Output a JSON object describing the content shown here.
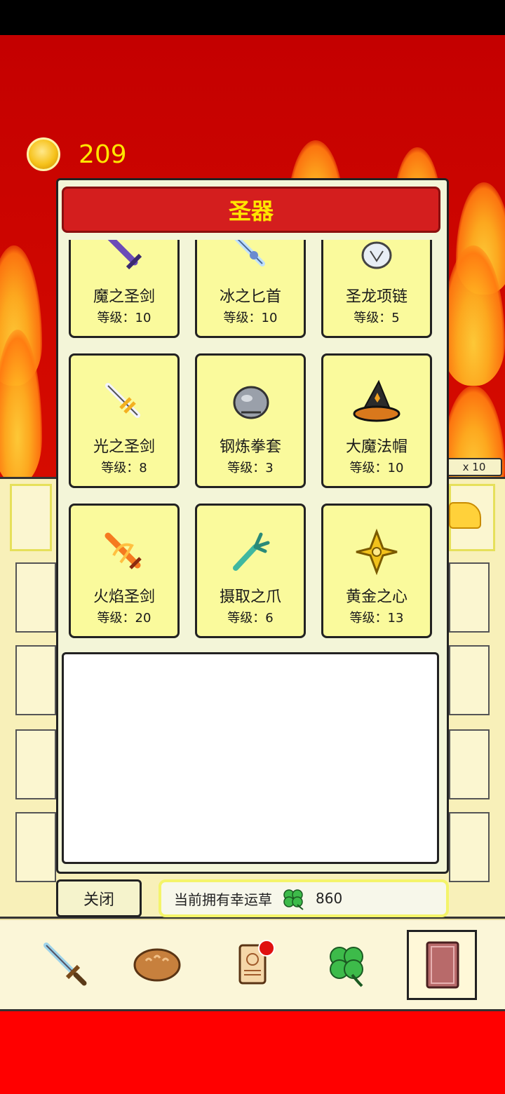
{
  "hud": {
    "gold": "209"
  },
  "modal": {
    "title": "圣器",
    "items": [
      {
        "name": "魔之圣剑",
        "level_text": "等级：10",
        "icon": "purple-sword-icon"
      },
      {
        "name": "冰之匕首",
        "level_text": "等级：10",
        "icon": "ice-dagger-icon"
      },
      {
        "name": "圣龙项链",
        "level_text": "等级：5",
        "icon": "dragon-necklace-icon"
      },
      {
        "name": "光之圣剑",
        "level_text": "等级：8",
        "icon": "light-sword-icon"
      },
      {
        "name": "钢炼拳套",
        "level_text": "等级：3",
        "icon": "steel-gauntlet-icon"
      },
      {
        "name": "大魔法帽",
        "level_text": "等级：10",
        "icon": "wizard-hat-icon"
      },
      {
        "name": "火焰圣剑",
        "level_text": "等级：20",
        "icon": "flame-sword-icon"
      },
      {
        "name": "摄取之爪",
        "level_text": "等级：6",
        "icon": "claw-icon"
      },
      {
        "name": "黄金之心",
        "level_text": "等级：13",
        "icon": "golden-heart-icon"
      }
    ],
    "close_label": "关闭",
    "clover_label": "当前拥有幸运草",
    "clover_count": "860"
  },
  "background": {
    "multiplier": "x 10"
  },
  "nav": {
    "items": [
      {
        "icon": "sword-icon"
      },
      {
        "icon": "bread-icon"
      },
      {
        "icon": "scroll-icon",
        "has_badge": true
      },
      {
        "icon": "clover-icon"
      },
      {
        "icon": "book-icon",
        "active": true
      }
    ]
  },
  "colors": {
    "header_red": "#d41e1e",
    "title_yellow": "#ffe600",
    "card_yellow": "#fafa9c",
    "badge_red": "#e01010"
  }
}
